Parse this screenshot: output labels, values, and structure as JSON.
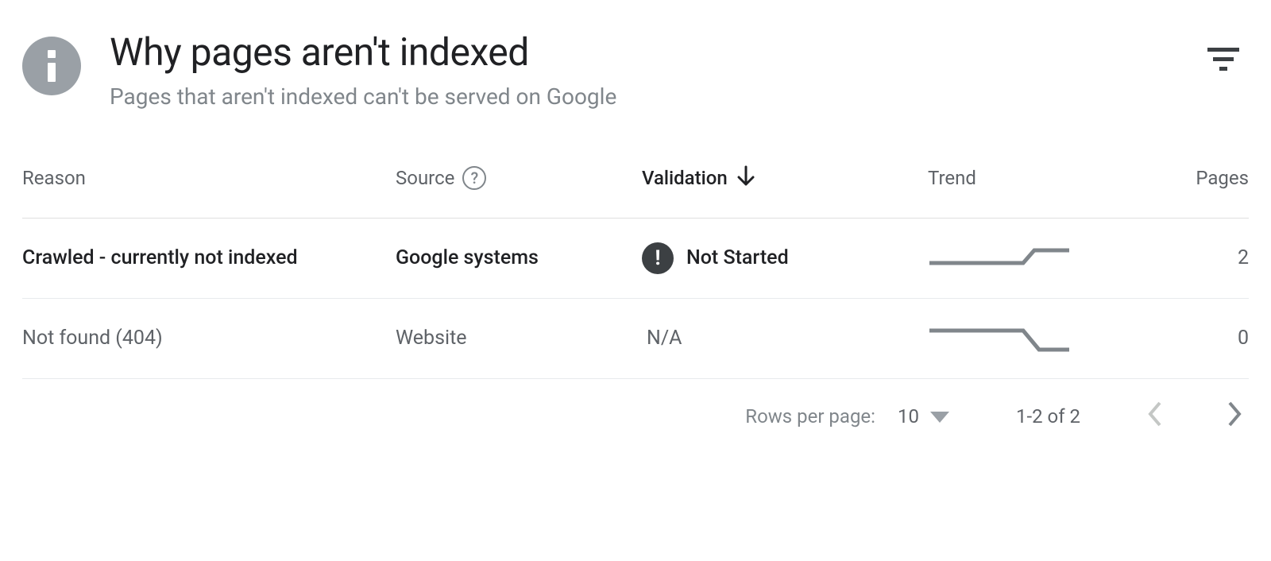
{
  "header": {
    "title": "Why pages aren't indexed",
    "subtitle": "Pages that aren't indexed can't be served on Google"
  },
  "columns": {
    "reason": "Reason",
    "source": "Source",
    "validation": "Validation",
    "trend": "Trend",
    "pages": "Pages"
  },
  "rows": [
    {
      "reason": "Crawled - currently not indexed",
      "source": "Google systems",
      "validation_status": "Not Started",
      "validation_icon": "!",
      "trend_shape": "up",
      "pages": "2",
      "bold": true
    },
    {
      "reason": "Not found (404)",
      "source": "Website",
      "validation_status": "N/A",
      "validation_icon": "",
      "trend_shape": "down",
      "pages": "0",
      "bold": false
    }
  ],
  "footer": {
    "rows_per_page_label": "Rows per page:",
    "rows_per_page_value": "10",
    "range": "1-2 of 2"
  }
}
